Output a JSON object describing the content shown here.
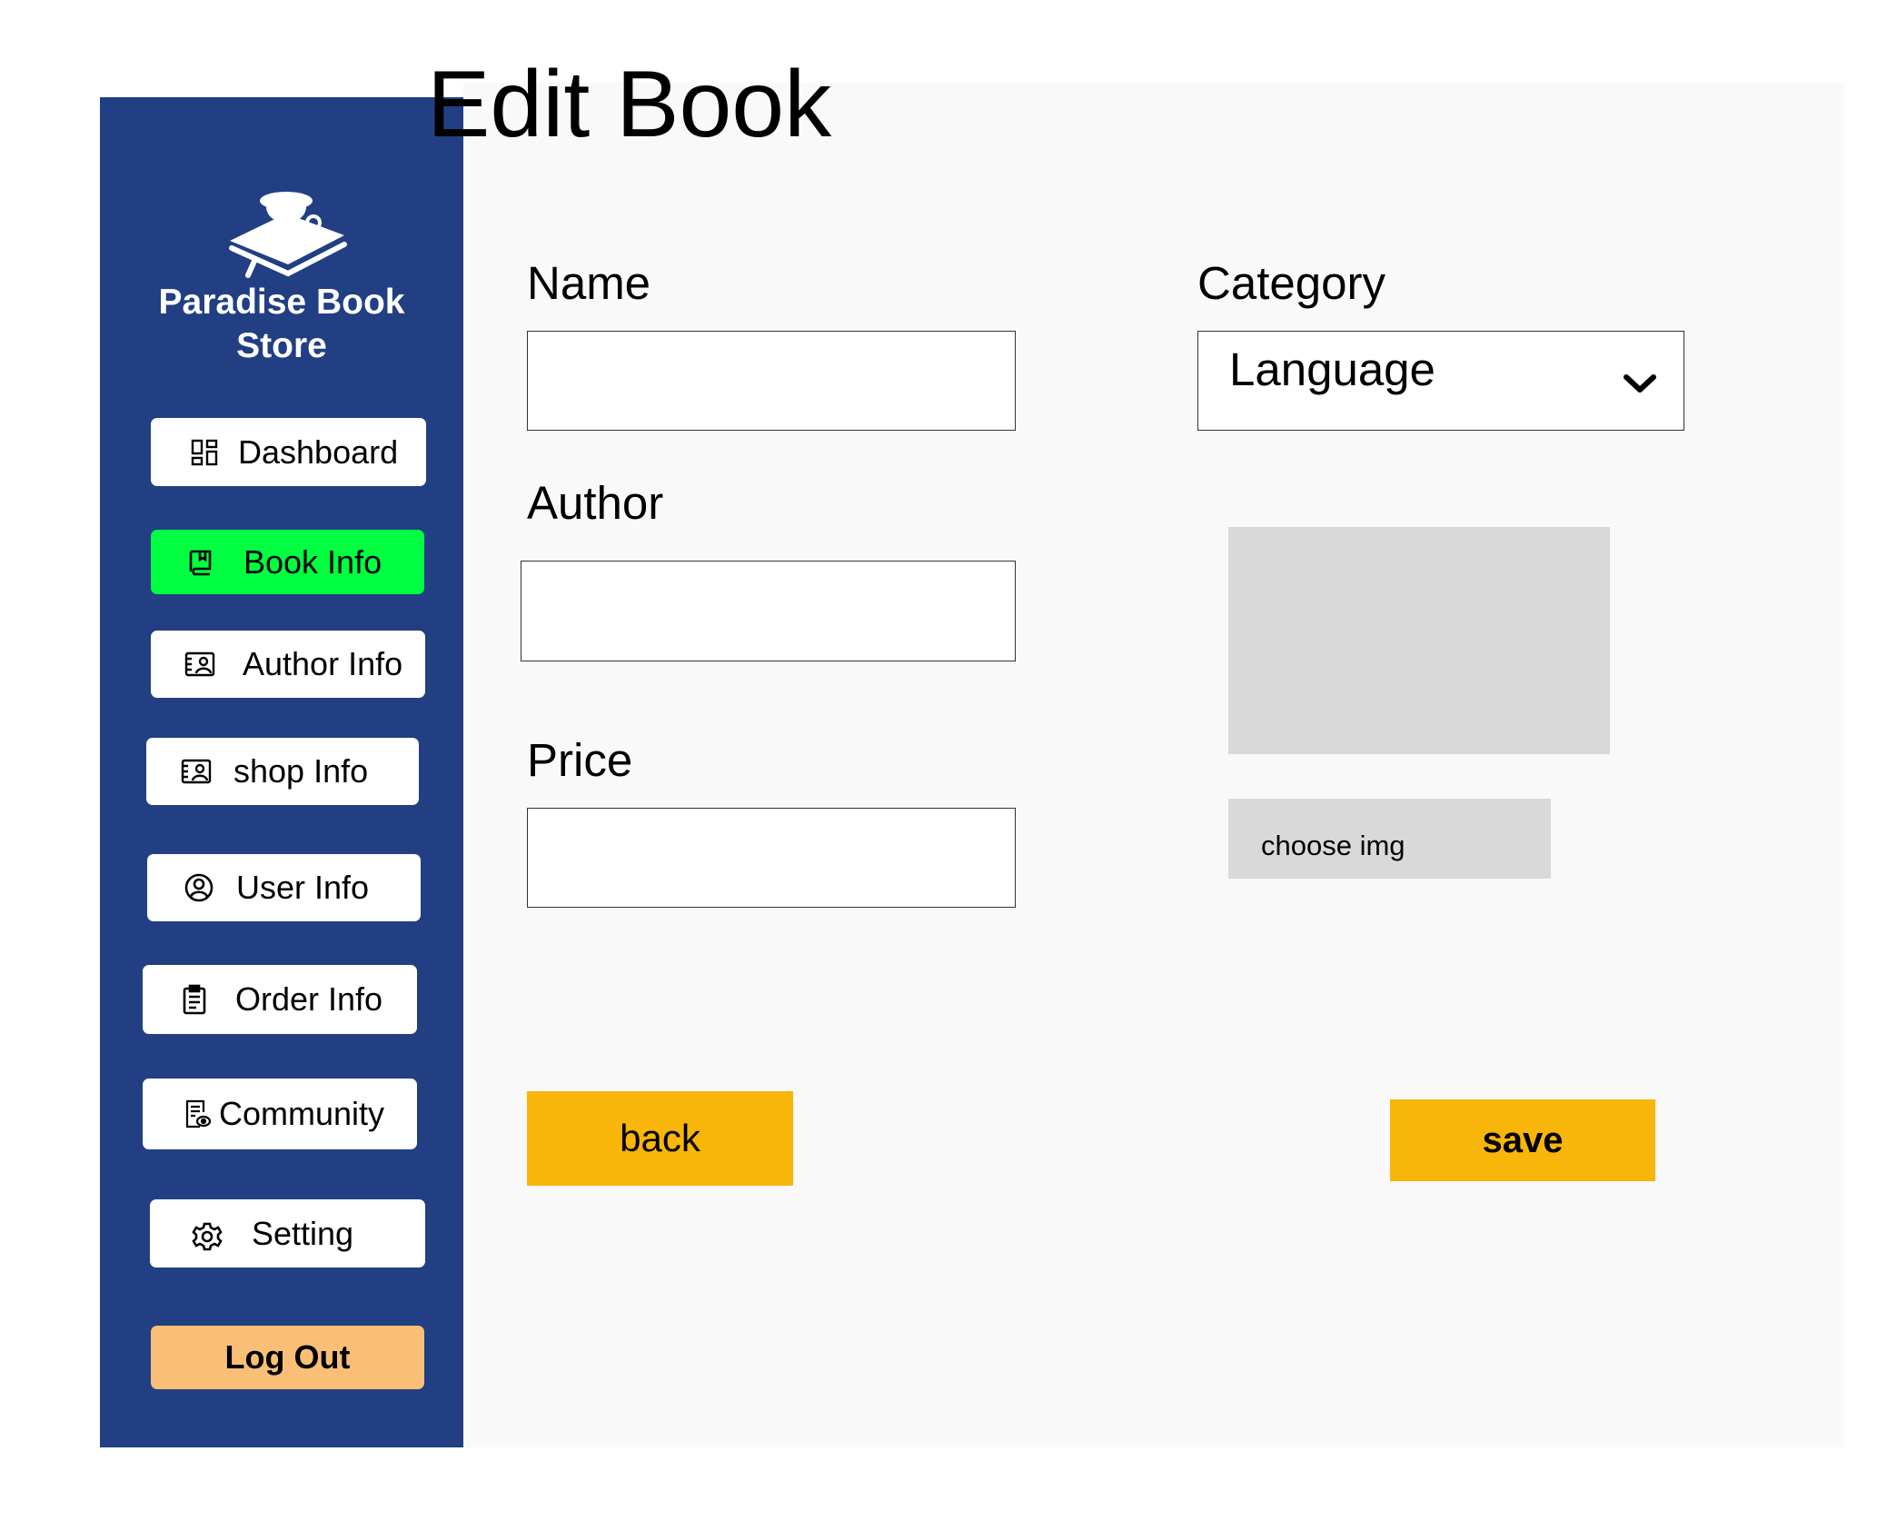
{
  "brand": {
    "name": "Paradise Book Store",
    "logo_icon": "book-with-cup-logo"
  },
  "colors": {
    "sidebar": "#213f82",
    "active_nav": "#00ff40",
    "logout": "#f9bf76",
    "action_button": "#f8b50a",
    "placeholder_gray": "#d9d9d9"
  },
  "sidebar": {
    "items": [
      {
        "label": "Dashboard",
        "icon": "dashboard-icon",
        "active": false
      },
      {
        "label": "Book Info",
        "icon": "book-icon",
        "active": true
      },
      {
        "label": "Author Info",
        "icon": "contact-card-icon",
        "active": false
      },
      {
        "label": "shop Info",
        "icon": "contact-card-icon",
        "active": false
      },
      {
        "label": "User Info",
        "icon": "user-circle-icon",
        "active": false
      },
      {
        "label": "Order Info",
        "icon": "clipboard-icon",
        "active": false
      },
      {
        "label": "Community",
        "icon": "document-eye-icon",
        "active": false
      },
      {
        "label": "Setting",
        "icon": "gear-icon",
        "active": false
      }
    ],
    "logout_label": "Log Out"
  },
  "page": {
    "title": "Edit Book"
  },
  "form": {
    "name_label": "Name",
    "name_value": "",
    "author_label": "Author",
    "author_value": "",
    "price_label": "Price",
    "price_value": "",
    "category_label": "Category",
    "category_value": "Language",
    "choose_img_label": "choose img",
    "back_label": "back",
    "save_label": "save"
  }
}
